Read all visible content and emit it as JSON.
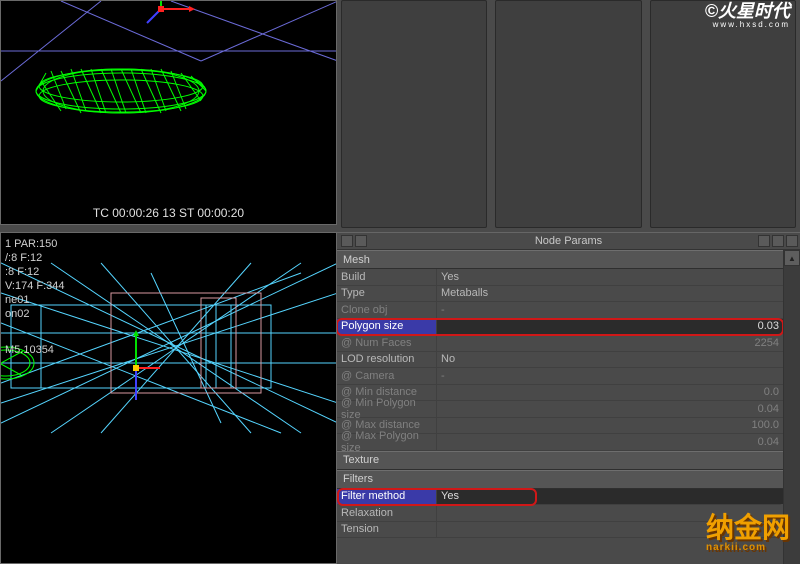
{
  "viewportTop": {
    "timecode": "TC 00:00:26 13    ST 00:00:20"
  },
  "viewportBottom": {
    "labels": [
      "1 PAR:150",
      "/:8 F:12",
      ":8 F:12",
      "V:174 F:344",
      "ne01",
      "on02",
      "M5.10354"
    ]
  },
  "previewSlots": [
    "",
    "",
    ""
  ],
  "panel": {
    "title": "Node Params",
    "sections": [
      {
        "header": "Mesh",
        "rows": [
          {
            "label": "Build",
            "value": "Yes",
            "dim": false,
            "sel": false,
            "align": "left",
            "hl": false
          },
          {
            "label": "Type",
            "value": "Metaballs",
            "dim": false,
            "sel": false,
            "align": "left",
            "hl": false
          },
          {
            "label": "Clone obj",
            "value": "-",
            "dim": true,
            "sel": false,
            "align": "left",
            "hl": false
          },
          {
            "label": "Polygon size",
            "value": "0.03",
            "dim": false,
            "sel": true,
            "align": "right",
            "hl": true
          },
          {
            "label": "@ Num Faces",
            "value": "2254",
            "dim": true,
            "sel": false,
            "align": "right",
            "hl": false
          },
          {
            "label": "LOD resolution",
            "value": "No",
            "dim": false,
            "sel": false,
            "align": "left",
            "hl": false
          },
          {
            "label": "@ Camera",
            "value": "-",
            "dim": true,
            "sel": false,
            "align": "left",
            "hl": false
          },
          {
            "label": "@ Min distance",
            "value": "0.0",
            "dim": true,
            "sel": false,
            "align": "right",
            "hl": false
          },
          {
            "label": "@ Min Polygon size",
            "value": "0.04",
            "dim": true,
            "sel": false,
            "align": "right",
            "hl": false
          },
          {
            "label": "@ Max distance",
            "value": "100.0",
            "dim": true,
            "sel": false,
            "align": "right",
            "hl": false
          },
          {
            "label": "@ Max Polygon size",
            "value": "0.04",
            "dim": true,
            "sel": false,
            "align": "right",
            "hl": false
          }
        ]
      },
      {
        "header": "Texture",
        "rows": []
      },
      {
        "header": "Filters",
        "rows": [
          {
            "label": "Filter method",
            "value": "Yes",
            "dim": false,
            "sel": true,
            "align": "left",
            "hl": true,
            "hlshort": true
          },
          {
            "label": "Relaxation",
            "value": "",
            "dim": false,
            "sel": false,
            "align": "left",
            "hl": false
          },
          {
            "label": "Tension",
            "value": "",
            "dim": false,
            "sel": false,
            "align": "left",
            "hl": false
          }
        ]
      }
    ]
  },
  "watermark1": {
    "main": "©火星时代",
    "sub": "www.hxsd.com"
  },
  "watermark2": {
    "main": "纳金网",
    "sub": "narkii.com"
  }
}
